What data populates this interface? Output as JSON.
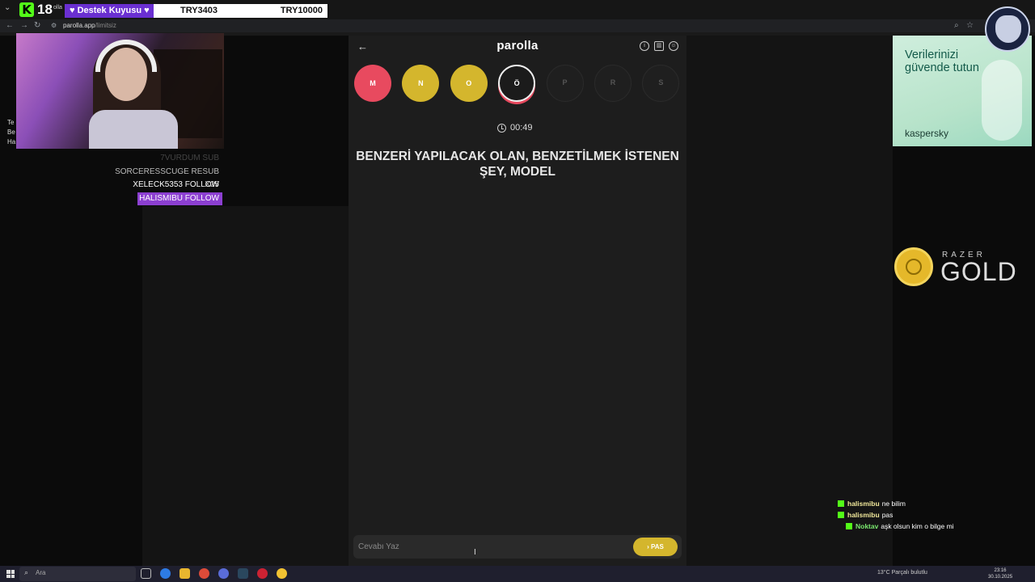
{
  "overlay": {
    "age_badge": "18",
    "tiny_text": "olla",
    "destek": "♥ Destek Kuyusu ♥",
    "try_left": "TRY3403",
    "try_right": "TRY10000"
  },
  "browser": {
    "url_host": "parolla.app",
    "url_path": "/limitsiz"
  },
  "side_letters": [
    "Te",
    "Be",
    "Ha"
  ],
  "alerts": [
    {
      "text": "7VURDUM  SUB"
    },
    {
      "text": "SORCERESSCUGE  RESUB X25"
    },
    {
      "text": "XELECK5353  FOLLOW"
    },
    {
      "text": "HALISMIBU  FOLLOW"
    }
  ],
  "game": {
    "brand": "parolla",
    "letters": [
      {
        "char": "M",
        "state": "wrong",
        "color": "#e84a5f"
      },
      {
        "char": "N",
        "state": "passed",
        "color": "#d4b62d"
      },
      {
        "char": "O",
        "state": "passed",
        "color": "#d4b62d"
      },
      {
        "char": "Ö",
        "state": "active"
      },
      {
        "char": "P",
        "state": "pending"
      },
      {
        "char": "R",
        "state": "pending"
      },
      {
        "char": "S",
        "state": "pending"
      }
    ],
    "timer": "00:49",
    "question": "BENZERİ YAPILACAK OLAN, BENZETİLMEK İSTENEN ŞEY, MODEL",
    "answer_placeholder": "Cevabı Yaz",
    "pass_label": "PAS"
  },
  "ads": {
    "kaspersky_headline": "Verilerinizi güvende tutun",
    "kaspersky_brand": "kaspersky",
    "razer_name": "RAZER",
    "razer_gold": "GOLD"
  },
  "chat": [
    {
      "user": "halismibu",
      "message": "ne bilim"
    },
    {
      "user": "halismibu",
      "message": "pas"
    },
    {
      "user": "Noktav",
      "message": "aşk olsun kim o bilge mi"
    }
  ],
  "taskbar": {
    "search_placeholder": "Ara",
    "weather": "13°C  Parçalı bulutlu",
    "time": "23:16",
    "date": "30.10.2025"
  }
}
